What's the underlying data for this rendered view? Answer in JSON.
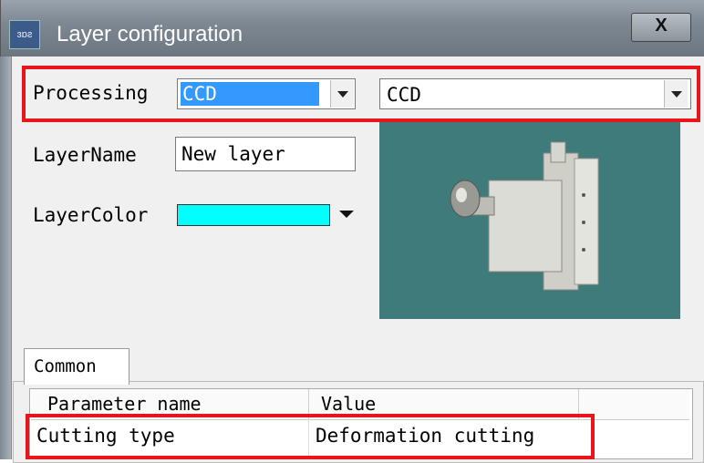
{
  "window": {
    "title": "Layer configuration",
    "icon_text": "ɜɒƨ",
    "close_label": "X"
  },
  "processing": {
    "label": "Processing",
    "mode_value": "CCD",
    "type_value": "CCD"
  },
  "layer_name": {
    "label": "LayerName",
    "value": "New layer"
  },
  "layer_color": {
    "label": "LayerColor",
    "value": "#00ffff"
  },
  "preview": {
    "icon": "ccd-camera-head-image"
  },
  "tabs": [
    {
      "label": "Common"
    }
  ],
  "grid": {
    "columns": [
      "Parameter name",
      "Value"
    ],
    "rows": [
      {
        "name": "Cutting type",
        "value": "Deformation cutting"
      }
    ]
  },
  "colors": {
    "highlight_frame": "#e8161b",
    "selection": "#3399ff",
    "preview_bg": "#3f7b7a"
  }
}
